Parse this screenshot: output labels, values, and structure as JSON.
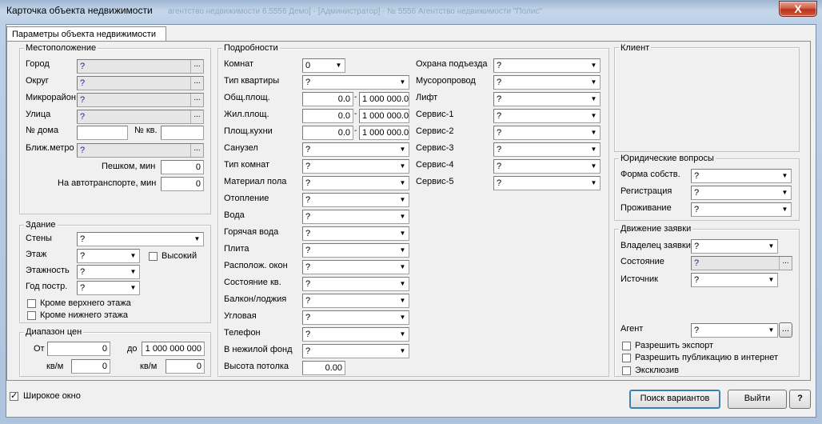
{
  "window": {
    "title": "Карточка объекта недвижимости",
    "background_title": "агентство недвижимости 6.5556 Демо] - [Администратор] - № 5556 Агентство недвижимости \"Полис\"",
    "close_glyph": "X"
  },
  "tab": {
    "label": "Параметры объекта недвижимости"
  },
  "location": {
    "title": "Местоположение",
    "city_label": "Город",
    "city_value": "?",
    "district_label": "Округ",
    "district_value": "?",
    "microdistrict_label": "Микрорайон",
    "microdistrict_value": "?",
    "street_label": "Улица",
    "street_value": "?",
    "house_label": "№ дома",
    "house_value": "",
    "apt_label": "№ кв.",
    "apt_value": "",
    "metro_label": "Ближ.метро",
    "metro_value": "?",
    "walk_label": "Пешком, мин",
    "walk_value": "0",
    "transport_label": "На автотранспорте, мин",
    "transport_value": "0",
    "browse_glyph": "..."
  },
  "building": {
    "title": "Здание",
    "walls_label": "Стены",
    "walls_value": "?",
    "floor_label": "Этаж",
    "floor_value": "?",
    "high_label": "Высокий",
    "floors_label": "Этажность",
    "floors_value": "?",
    "year_label": "Год постр.",
    "year_value": "?",
    "not_top_label": "Кроме верхнего этажа",
    "not_bottom_label": "Кроме нижнего этажа"
  },
  "price": {
    "title": "Диапазон цен",
    "from_label": "От",
    "from_value": "0",
    "to_label": "до",
    "to_value": "1 000 000 000",
    "sqm1_label": "кв/м",
    "sqm1_value": "0",
    "sqm2_label": "кв/м",
    "sqm2_value": "0"
  },
  "details": {
    "title": "Подробности",
    "rooms_label": "Комнат",
    "rooms_value": "0",
    "apt_type_label": "Тип квартиры",
    "apt_type_value": "?",
    "total_area_label": "Общ.площ.",
    "total_area_from": "0.0",
    "total_area_to": "1 000 000.0",
    "living_area_label": "Жил.площ.",
    "living_area_from": "0.0",
    "living_area_to": "1 000 000.0",
    "kitchen_area_label": "Площ.кухни",
    "kitchen_area_from": "0.0",
    "kitchen_area_to": "1 000 000.0",
    "range_sep": "-",
    "fields": [
      {
        "label": "Санузел",
        "value": "?"
      },
      {
        "label": "Тип комнат",
        "value": "?"
      },
      {
        "label": "Материал пола",
        "value": "?"
      },
      {
        "label": "Отопление",
        "value": "?"
      },
      {
        "label": "Вода",
        "value": "?"
      },
      {
        "label": "Горячая вода",
        "value": "?"
      },
      {
        "label": "Плита",
        "value": "?"
      },
      {
        "label": "Располож. окон",
        "value": "?"
      },
      {
        "label": "Состояние кв.",
        "value": "?"
      },
      {
        "label": "Балкон/лоджия",
        "value": "?"
      },
      {
        "label": "Угловая",
        "value": "?"
      },
      {
        "label": "Телефон",
        "value": "?"
      },
      {
        "label": "В нежилой фонд",
        "value": "?"
      }
    ],
    "ceiling_label": "Высота потолка",
    "ceiling_value": "0.00",
    "right_fields": [
      {
        "label": "Охрана подъезда",
        "value": "?"
      },
      {
        "label": "Мусоропровод",
        "value": "?"
      },
      {
        "label": "Лифт",
        "value": "?"
      },
      {
        "label": "Сервис-1",
        "value": "?"
      },
      {
        "label": "Сервис-2",
        "value": "?"
      },
      {
        "label": "Сервис-3",
        "value": "?"
      },
      {
        "label": "Сервис-4",
        "value": "?"
      },
      {
        "label": "Сервис-5",
        "value": "?"
      }
    ]
  },
  "client": {
    "title": "Клиент"
  },
  "legal": {
    "title": "Юридические вопросы",
    "ownership_label": "Форма собств.",
    "ownership_value": "?",
    "registration_label": "Регистрация",
    "registration_value": "?",
    "residence_label": "Проживание",
    "residence_value": "?"
  },
  "request": {
    "title": "Движение заявки",
    "owner_label": "Владелец заявки",
    "owner_value": "?",
    "state_label": "Состояние",
    "state_value": "?",
    "source_label": "Источник",
    "source_value": "?",
    "agent_label": "Агент",
    "agent_value": "?",
    "allow_export_label": "Разрешить экспорт",
    "allow_publish_label": "Разрешить публикацию в интернет",
    "exclusive_label": "Эксклюзив"
  },
  "footer": {
    "wide_window_label": "Широкое окно",
    "search_button": "Поиск вариантов",
    "exit_button": "Выйти",
    "help_button": "?"
  },
  "colors": {
    "question_mark": "#1a1aa0",
    "close_button": "#c8462b"
  }
}
